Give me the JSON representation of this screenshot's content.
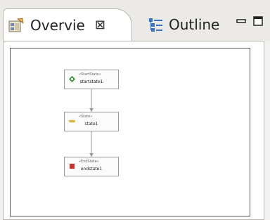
{
  "tabs": {
    "overview_label": "Overvie",
    "overview_close": "⊠",
    "outline_label": "Outline"
  },
  "window_controls": {
    "minimize_icon": "minimize-icon",
    "maximize_icon": "maximize-icon"
  },
  "diagram": {
    "nodes": [
      {
        "stereotype": "«StartState»",
        "name": "startstate1",
        "icon": "start-state-icon",
        "color": "#2e8b2e"
      },
      {
        "stereotype": "«State»",
        "name": "state1",
        "icon": "state-icon",
        "color": "#d9b84a"
      },
      {
        "stereotype": "«EndState»",
        "name": "endstate1",
        "icon": "end-state-icon",
        "color": "#d23030"
      }
    ]
  },
  "colors": {
    "tab_active_bg": "#ffffff",
    "panel_bg": "#ffffff",
    "frame_border": "#b8b6b0"
  }
}
